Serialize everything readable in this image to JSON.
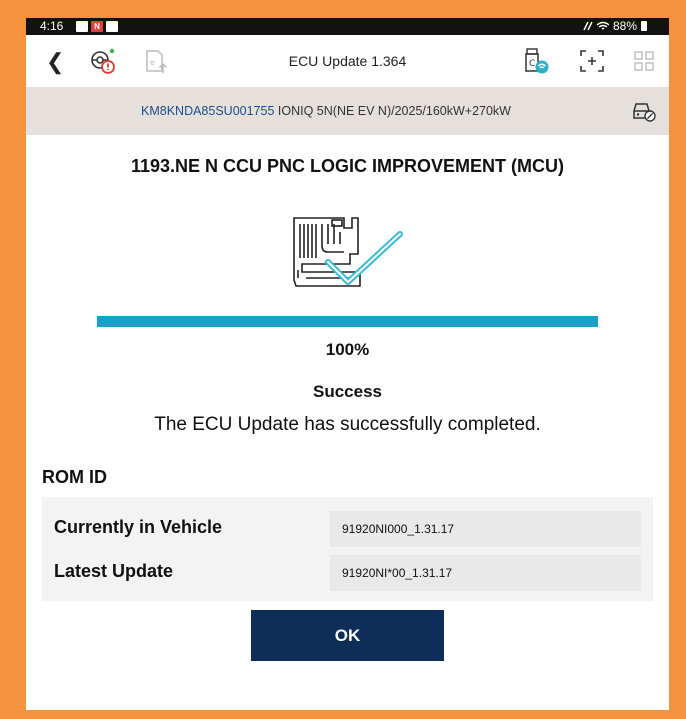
{
  "status_bar": {
    "time": "4:16",
    "battery": "88%"
  },
  "app_bar": {
    "back_icon": "chevron-left-icon",
    "title": "ECU Update 1.364"
  },
  "vehicle_bar": {
    "vin": "KM8KNDA85SU001755",
    "model": "IONIQ 5N(NE EV N)/2025/160kW+270kW"
  },
  "update": {
    "heading": "1193.NE N CCU PNC LOGIC IMPROVEMENT (MCU)",
    "progress_percent": 100,
    "progress_label": "100%",
    "status_title": "Success",
    "status_message": "The ECU Update has successfully completed."
  },
  "rom": {
    "label": "ROM ID",
    "rows": [
      {
        "label": "Currently in Vehicle",
        "value": "91920NI000_1.31.17"
      },
      {
        "label": "Latest Update",
        "value": "91920NI*00_1.31.17"
      }
    ]
  },
  "ok_label": "OK",
  "colors": {
    "frame": "#f5923e",
    "progress": "#1aa0c8",
    "button": "#0e2d58",
    "vin": "#1f4d8c",
    "alert": "#e53935",
    "online": "#39b54a"
  }
}
